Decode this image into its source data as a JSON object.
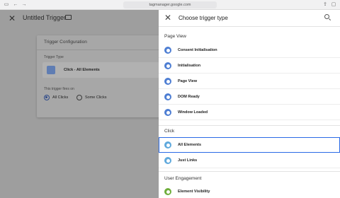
{
  "browser": {
    "url": "tagmanager.google.com"
  },
  "editor": {
    "title": "Untitled Trigger",
    "card_title": "Trigger Configuration",
    "trigger_type_label": "Trigger Type",
    "trigger_type_value": "Click - All Elements",
    "fires_on_label": "This trigger fires on",
    "option_all": "All Clicks",
    "option_some": "Some Clicks",
    "selected_option": "All Clicks"
  },
  "panel": {
    "title": "Choose trigger type",
    "sections": [
      {
        "title": "Page View",
        "items": [
          {
            "label": "Consent Initialisation",
            "icon": "consent-icon",
            "color": "#4e7ed3"
          },
          {
            "label": "Initialisation",
            "icon": "init-icon",
            "color": "#4e7ed3"
          },
          {
            "label": "Page View",
            "icon": "eye-icon",
            "color": "#4e7ed3"
          },
          {
            "label": "DOM Ready",
            "icon": "dom-icon",
            "color": "#4e7ed3"
          },
          {
            "label": "Window Loaded",
            "icon": "window-icon",
            "color": "#4e7ed3"
          }
        ]
      },
      {
        "title": "Click",
        "items": [
          {
            "label": "All Elements",
            "icon": "click-icon",
            "color": "#5fa9dd",
            "highlighted": true
          },
          {
            "label": "Just Links",
            "icon": "link-icon",
            "color": "#5fa9dd"
          }
        ]
      },
      {
        "title": "User Engagement",
        "items": [
          {
            "label": "Element Visibility",
            "icon": "visibility-icon",
            "color": "#6fae3b"
          }
        ]
      }
    ]
  },
  "colors": {
    "accent": "#2a6ae6",
    "page_view_icon": "#4e7ed3",
    "click_icon": "#5fa9dd",
    "engagement_icon": "#6fae3b"
  }
}
